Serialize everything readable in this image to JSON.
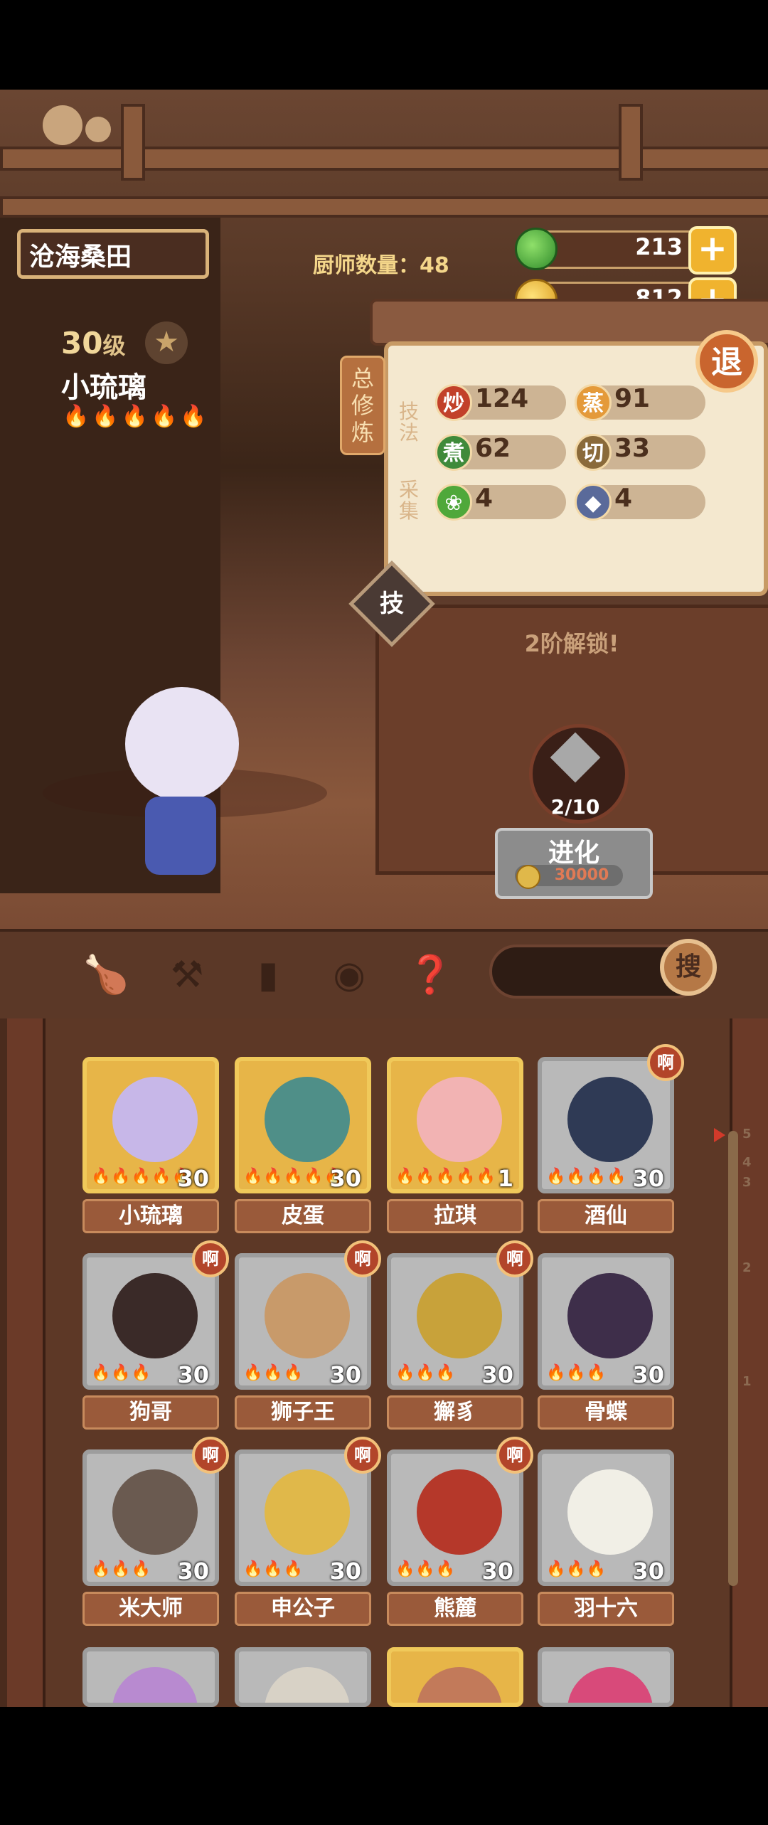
{
  "location": "沧海桑田",
  "chef_count": {
    "label": "厨师数量：",
    "value": "48"
  },
  "resources": {
    "jade": {
      "value": "213",
      "icon": "green-jade-icon"
    },
    "coins": {
      "value": "812",
      "icon": "gold-coin-icon"
    }
  },
  "character": {
    "level": "30",
    "level_unit": "级",
    "name": "小琉璃",
    "flames": "🔥🔥🔥🔥🔥"
  },
  "panel": {
    "tag": "总修炼",
    "exit": "退",
    "skill_label": "技法",
    "gather_label": "采集",
    "stats": [
      {
        "icon": "炒",
        "value": "124"
      },
      {
        "icon": "蒸",
        "value": "91"
      },
      {
        "icon": "煮",
        "value": "62"
      },
      {
        "icon": "切",
        "value": "33"
      },
      {
        "icon": "vegetable-icon",
        "value": "4"
      },
      {
        "icon": "fish-icon",
        "value": "4"
      }
    ],
    "skill_button": "技",
    "unlock_text": "2阶解锁!",
    "evolve": {
      "count": "2/10",
      "label": "进化",
      "cost": "30000"
    }
  },
  "toolbar": {
    "search_label": "搜"
  },
  "cards": [
    {
      "name": "小琉璃",
      "level": "30",
      "stars": "🔥🔥🔥🔥🔥",
      "gold": true,
      "badge": "",
      "color": "#c7b7e8"
    },
    {
      "name": "皮蛋",
      "level": "30",
      "stars": "🔥🔥🔥🔥🔥",
      "gold": true,
      "badge": "",
      "color": "#4f8f88"
    },
    {
      "name": "拉琪",
      "level": "1",
      "stars": "🔥🔥🔥🔥🔥",
      "gold": true,
      "badge": "",
      "color": "#f2b3b3"
    },
    {
      "name": "酒仙",
      "level": "30",
      "stars": "🔥🔥🔥🔥",
      "gold": false,
      "badge": "啊",
      "color": "#2f3a55"
    },
    {
      "name": "狗哥",
      "level": "30",
      "stars": "🔥🔥🔥",
      "gold": false,
      "badge": "啊",
      "color": "#3a2a28"
    },
    {
      "name": "狮子王",
      "level": "30",
      "stars": "🔥🔥🔥",
      "gold": false,
      "badge": "啊",
      "color": "#c89a6a"
    },
    {
      "name": "獬豸",
      "level": "30",
      "stars": "🔥🔥🔥",
      "gold": false,
      "badge": "啊",
      "color": "#c8a23a"
    },
    {
      "name": "骨蝶",
      "level": "30",
      "stars": "🔥🔥🔥",
      "gold": false,
      "badge": "",
      "color": "#3e2e4a"
    },
    {
      "name": "米大师",
      "level": "30",
      "stars": "🔥🔥🔥",
      "gold": false,
      "badge": "啊",
      "color": "#6a5a50"
    },
    {
      "name": "申公子",
      "level": "30",
      "stars": "🔥🔥🔥",
      "gold": false,
      "badge": "啊",
      "color": "#e0b84a"
    },
    {
      "name": "熊麓",
      "level": "30",
      "stars": "🔥🔥🔥",
      "gold": false,
      "badge": "啊",
      "color": "#b5382a"
    },
    {
      "name": "羽十六",
      "level": "30",
      "stars": "🔥🔥🔥",
      "gold": false,
      "badge": "",
      "color": "#f1efe6"
    }
  ],
  "ruler_marks": [
    "5",
    "4",
    "3",
    "2",
    "1"
  ]
}
